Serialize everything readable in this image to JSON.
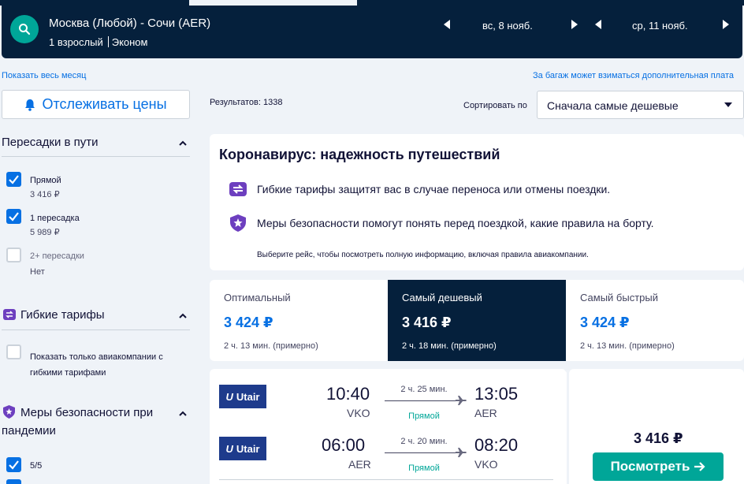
{
  "search": {
    "route": "Москва (Любой) - Сочи (AER)",
    "passengers": "1 взрослый",
    "cabin": "Эконом",
    "outbound_date": "вс, 8 нояб.",
    "return_date": "ср, 11 нояб."
  },
  "links": {
    "show_month": "Показать весь месяц",
    "baggage_note": "За багаж может взиматься дополнительная плата"
  },
  "track_prices_label": "Отслеживать цены",
  "results_count": "Результатов: 1338",
  "sort": {
    "label": "Сортировать по",
    "selected": "Сначала самые дешевые"
  },
  "filters": {
    "stops": {
      "title": "Пересадки в пути",
      "options": [
        {
          "label": "Прямой",
          "price": "3 416 ₽",
          "checked": true
        },
        {
          "label": "1 пересадка",
          "price": "5 989 ₽",
          "checked": true
        },
        {
          "label": "2+ пересадки",
          "price": "Нет",
          "checked": false
        }
      ]
    },
    "flexible": {
      "title": "Гибкие тарифы",
      "option_label": "Показать только авиакомпании с гибкими тарифами"
    },
    "safety": {
      "title": "Меры безопасности при пандемии",
      "option_label": "5/5"
    }
  },
  "covid": {
    "title": "Коронавирус: надежность путешествий",
    "line1": "Гибкие тарифы защитят вас в случае переноса или отмены поездки.",
    "line2": "Меры безопасности помогут понять перед поездкой, какие правила на борту.",
    "note": "Выберите рейс, чтобы посмотреть полную информацию, включая правила авиакомпании."
  },
  "tabs": [
    {
      "label": "Оптимальный",
      "price": "3 424 ₽",
      "time": "2 ч. 13 мин. (примерно)"
    },
    {
      "label": "Самый дешевый",
      "price": "3 416 ₽",
      "time": "2 ч. 18 мин. (примерно)"
    },
    {
      "label": "Самый быстрый",
      "price": "3 424 ₽",
      "time": "2 ч. 13 мин. (примерно)"
    }
  ],
  "ticket": {
    "legs": [
      {
        "airline": "Utair",
        "dep_time": "10:40",
        "dep_code": "VKO",
        "duration": "2 ч. 25 мин.",
        "type": "Прямой",
        "arr_time": "13:05",
        "arr_code": "AER"
      },
      {
        "airline": "Utair",
        "dep_time": "06:00",
        "dep_code": "AER",
        "duration": "2 ч. 20 мин.",
        "type": "Прямой",
        "arr_time": "08:20",
        "arr_code": "VKO"
      }
    ],
    "price": "3 416 ₽",
    "view_label": "Посмотреть"
  },
  "colors": {
    "navy": "#05203c",
    "accent_blue": "#0770e3",
    "teal": "#00a698",
    "page_bg": "#eff3f8"
  }
}
